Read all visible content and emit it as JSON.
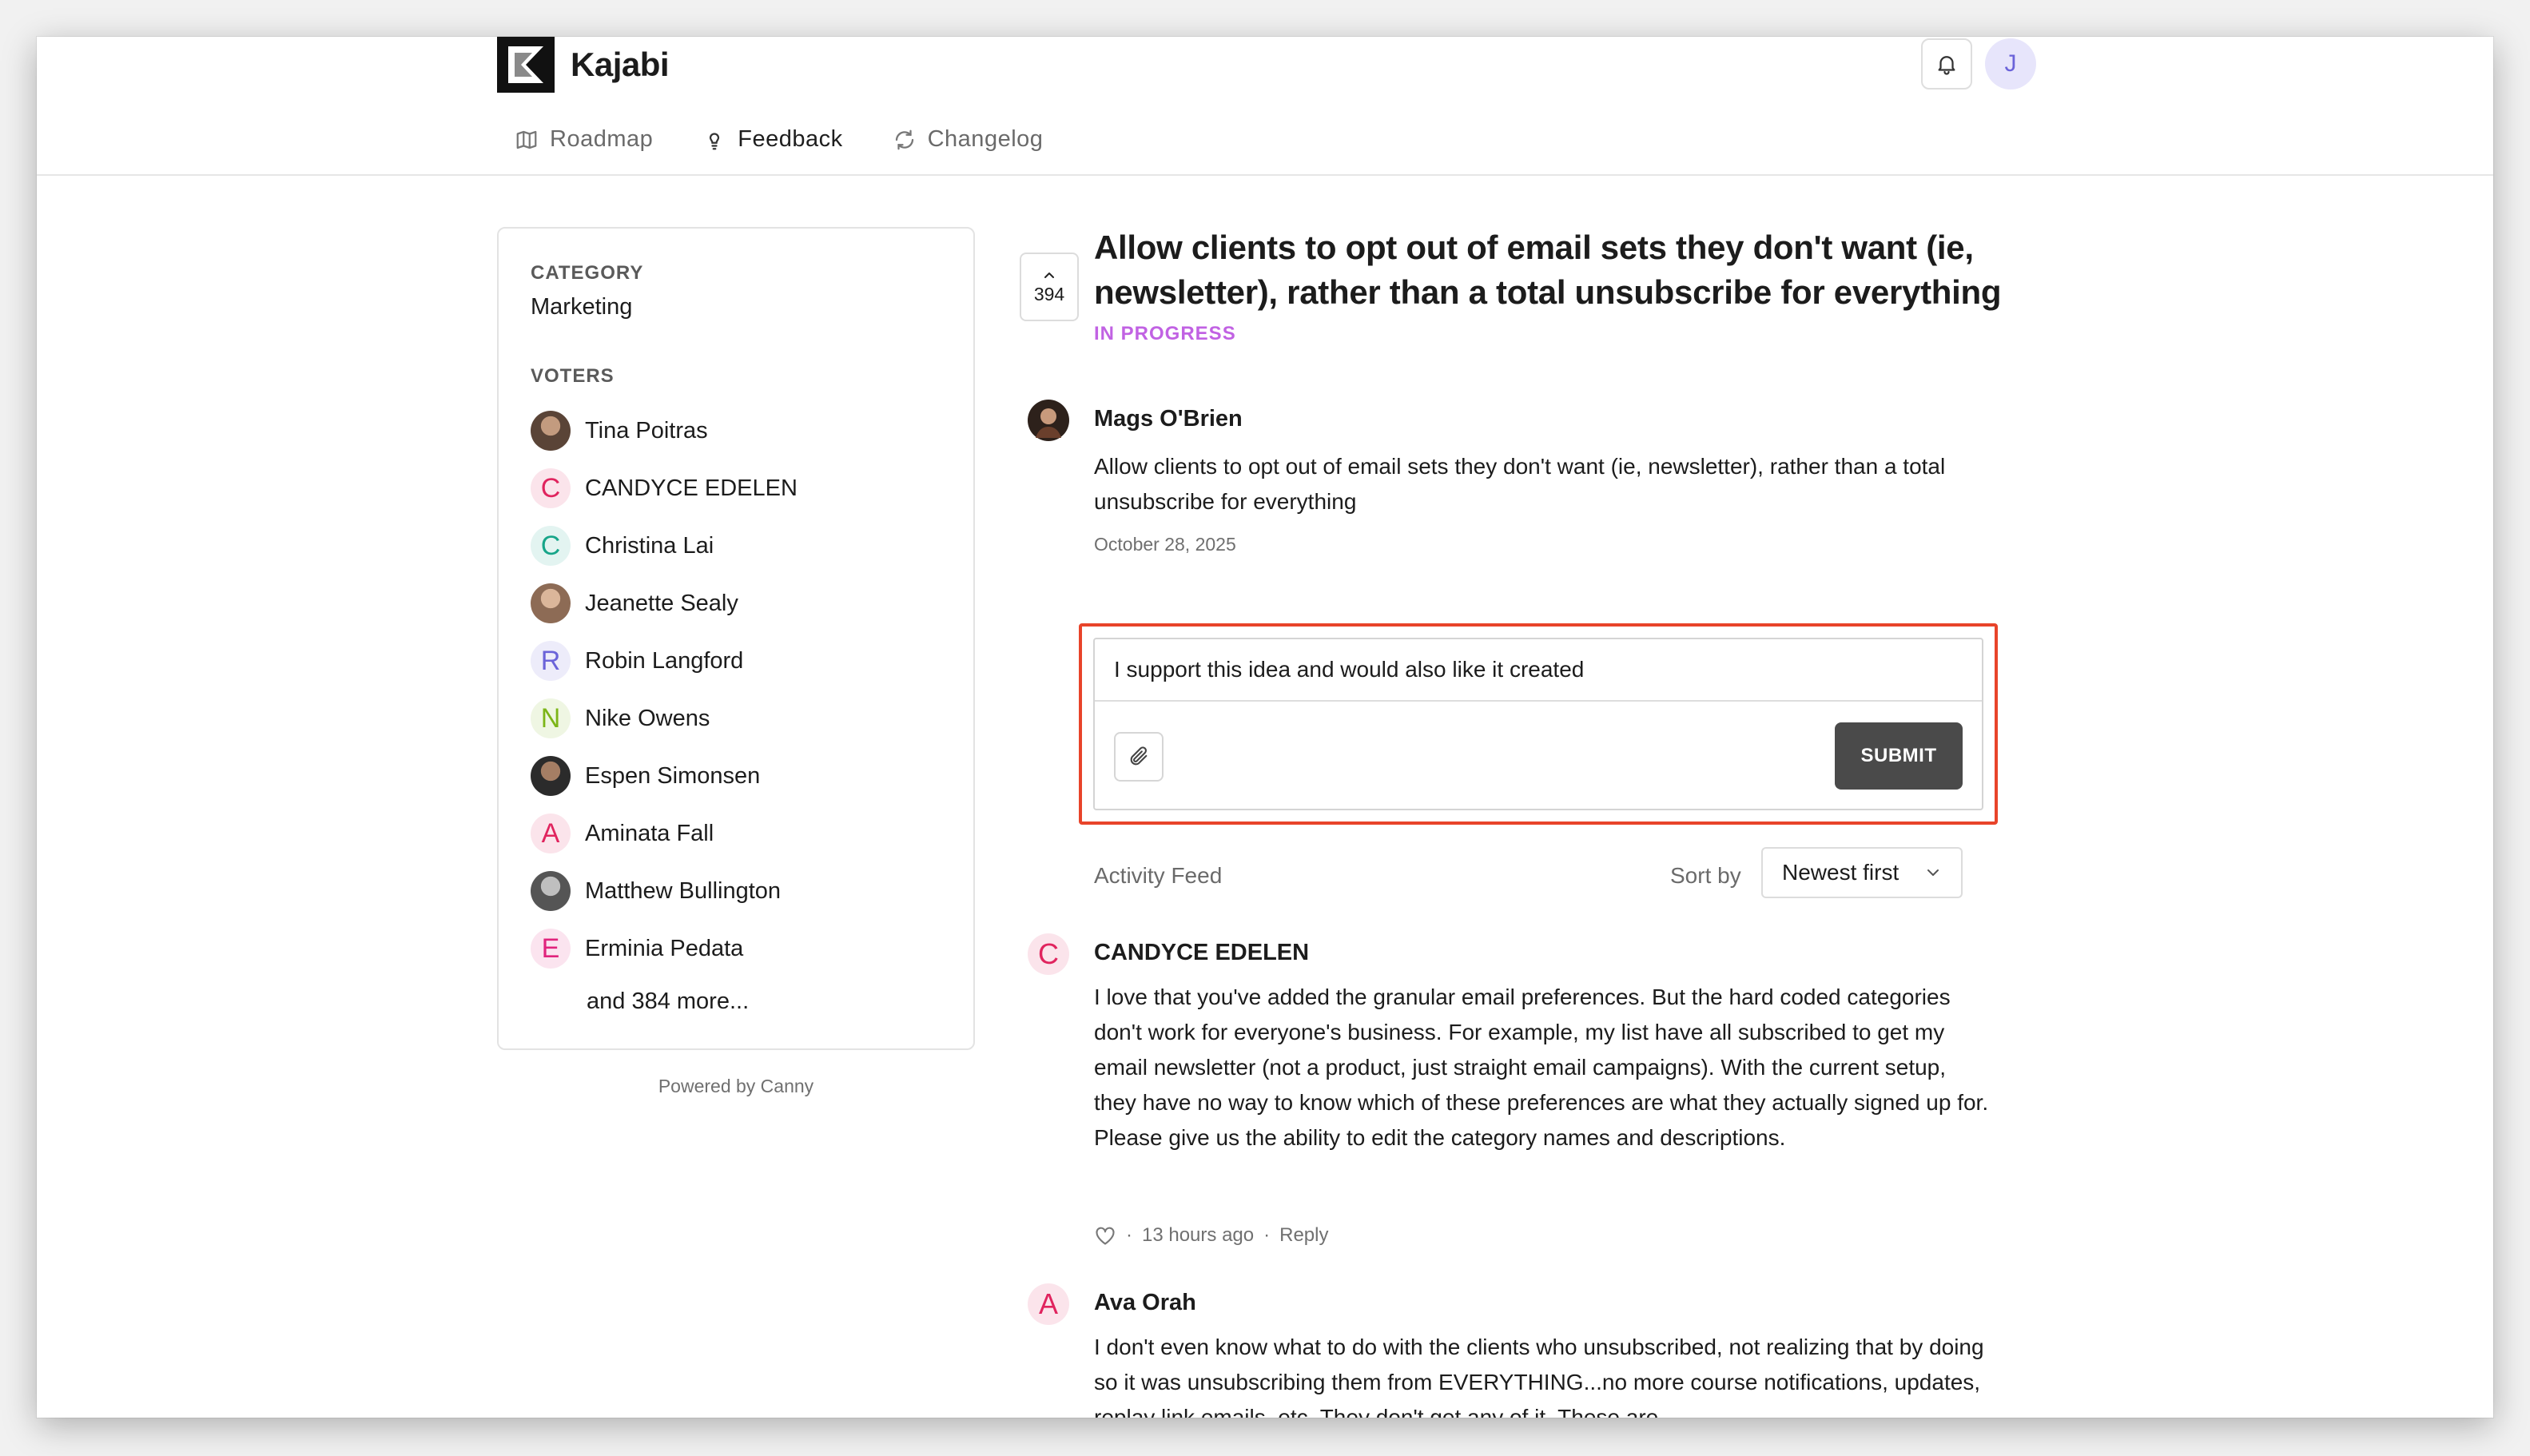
{
  "brand": {
    "name": "Kajabi"
  },
  "user": {
    "initial": "J"
  },
  "nav": [
    {
      "label": "Roadmap",
      "icon": "map-icon"
    },
    {
      "label": "Feedback",
      "icon": "lightbulb-icon"
    },
    {
      "label": "Changelog",
      "icon": "refresh-icon"
    }
  ],
  "sidebar": {
    "category_heading": "CATEGORY",
    "category_value": "Marketing",
    "voters_heading": "VOTERS",
    "voters": [
      {
        "name": "Tina Poitras",
        "initial": "",
        "color": ""
      },
      {
        "name": "CANDYCE EDELEN",
        "initial": "C",
        "color": "#e0245e"
      },
      {
        "name": "Christina Lai",
        "initial": "C",
        "color": "#17a589"
      },
      {
        "name": "Jeanette Sealy",
        "initial": "",
        "color": ""
      },
      {
        "name": "Robin Langford",
        "initial": "R",
        "color": "#6b63d9"
      },
      {
        "name": "Nike Owens",
        "initial": "N",
        "color": "#7cb518"
      },
      {
        "name": "Espen Simonsen",
        "initial": "",
        "color": ""
      },
      {
        "name": "Aminata Fall",
        "initial": "A",
        "color": "#e0245e"
      },
      {
        "name": "Matthew Bullington",
        "initial": "",
        "color": ""
      },
      {
        "name": "Erminia Pedata",
        "initial": "E",
        "color": "#e0247c"
      }
    ],
    "more": "and 384 more..."
  },
  "powered_by": "Powered by Canny",
  "post": {
    "votes": "394",
    "title": "Allow clients to opt out of email sets they don't want (ie, newsletter), rather than a total unsubscribe for everything",
    "status": "IN PROGRESS",
    "author": "Mags O'Brien",
    "body": "Allow clients to opt out of email sets they don't want (ie, newsletter), rather than a total unsubscribe for everything",
    "date": "October 28, 2025"
  },
  "composer": {
    "value": "I support this idea and would also like it created",
    "submit_label": "SUBMIT"
  },
  "activity": {
    "label": "Activity Feed",
    "sort_label": "Sort by",
    "sort_value": "Newest first"
  },
  "comments": [
    {
      "initial": "C",
      "color": "#e0245e",
      "name": "CANDYCE EDELEN",
      "body": "I love that you've added the granular email preferences. But the hard coded categories don't work for everyone's business. For example, my list have all subscribed to get my email newsletter (not a product, just straight email campaigns). With the current setup, they have no way to know which of these preferences are what they actually signed up for. Please give us the ability to edit the category names and descriptions.",
      "time": "13 hours ago",
      "reply": "Reply",
      "sep": "·"
    },
    {
      "initial": "A",
      "color": "#e0245e",
      "name": "Ava Orah",
      "body": "I don't even know what to do with the clients who unsubscribed, not realizing that by doing so it was unsubscribing them from EVERYTHING...no more course notifications, updates, replay link emails, etc. They don't get any of it. These are"
    }
  ]
}
